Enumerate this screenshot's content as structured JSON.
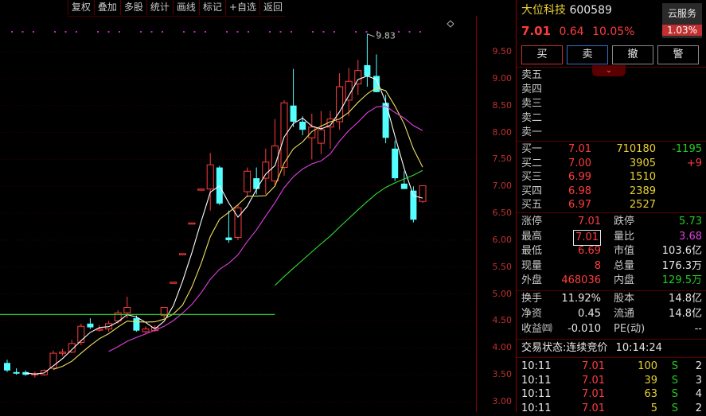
{
  "toolbar": [
    "复权",
    "叠加",
    "多股",
    "统计",
    "画线",
    "标记",
    "+自选",
    "返回"
  ],
  "chart_data": {
    "type": "candlestick",
    "peak_label": "9.83",
    "y_ticks": [
      "9.50",
      "9.00",
      "8.50",
      "8.00",
      "7.50",
      "7.00",
      "6.50",
      "6.00",
      "5.50",
      "5.00",
      "4.50",
      "4.00",
      "3.50",
      "3.00"
    ],
    "candles": [
      {
        "o": 3.72,
        "h": 3.78,
        "l": 3.55,
        "c": 3.58
      },
      {
        "o": 3.55,
        "h": 3.62,
        "l": 3.5,
        "c": 3.52
      },
      {
        "o": 3.55,
        "h": 3.58,
        "l": 3.48,
        "c": 3.5
      },
      {
        "o": 3.5,
        "h": 3.56,
        "l": 3.45,
        "c": 3.52
      },
      {
        "o": 3.5,
        "h": 3.6,
        "l": 3.48,
        "c": 3.58
      },
      {
        "o": 3.62,
        "h": 3.95,
        "l": 3.6,
        "c": 3.9
      },
      {
        "o": 3.9,
        "h": 3.98,
        "l": 3.85,
        "c": 3.92
      },
      {
        "o": 3.92,
        "h": 4.15,
        "l": 3.9,
        "c": 4.08
      },
      {
        "o": 4.1,
        "h": 4.45,
        "l": 4.05,
        "c": 4.4
      },
      {
        "o": 4.45,
        "h": 4.55,
        "l": 4.35,
        "c": 4.38
      },
      {
        "o": 4.35,
        "h": 4.42,
        "l": 4.3,
        "c": 4.35
      },
      {
        "o": 4.35,
        "h": 4.5,
        "l": 4.3,
        "c": 4.45
      },
      {
        "o": 4.5,
        "h": 4.7,
        "l": 4.45,
        "c": 4.65
      },
      {
        "o": 4.65,
        "h": 4.95,
        "l": 4.55,
        "c": 4.75
      },
      {
        "o": 4.55,
        "h": 4.6,
        "l": 4.3,
        "c": 4.32
      },
      {
        "o": 4.3,
        "h": 4.4,
        "l": 4.25,
        "c": 4.35
      },
      {
        "o": 4.32,
        "h": 4.42,
        "l": 4.3,
        "c": 4.38
      },
      {
        "o": 4.6,
        "h": 4.75,
        "l": 4.55,
        "c": 4.75
      },
      {
        "o": 5.22,
        "h": 5.22,
        "l": 5.22,
        "c": 5.22
      },
      {
        "o": 5.75,
        "h": 5.75,
        "l": 5.75,
        "c": 5.75
      },
      {
        "o": 6.32,
        "h": 6.32,
        "l": 6.32,
        "c": 6.32
      },
      {
        "o": 6.95,
        "h": 6.95,
        "l": 6.95,
        "c": 6.95
      },
      {
        "o": 6.95,
        "h": 7.62,
        "l": 6.55,
        "c": 7.4
      },
      {
        "o": 7.35,
        "h": 7.38,
        "l": 6.65,
        "c": 6.68
      },
      {
        "o": 6.05,
        "h": 6.55,
        "l": 5.95,
        "c": 6.0
      },
      {
        "o": 6.05,
        "h": 6.65,
        "l": 6.0,
        "c": 6.6
      },
      {
        "o": 6.9,
        "h": 7.35,
        "l": 6.8,
        "c": 7.28
      },
      {
        "o": 7.15,
        "h": 7.35,
        "l": 6.85,
        "c": 6.95
      },
      {
        "o": 7.15,
        "h": 7.7,
        "l": 6.85,
        "c": 7.45
      },
      {
        "o": 7.1,
        "h": 8.25,
        "l": 7.0,
        "c": 7.75
      },
      {
        "o": 7.35,
        "h": 8.6,
        "l": 7.2,
        "c": 8.55
      },
      {
        "o": 8.5,
        "h": 9.18,
        "l": 8.1,
        "c": 8.2
      },
      {
        "o": 8.2,
        "h": 8.3,
        "l": 7.95,
        "c": 8.05
      },
      {
        "o": 7.9,
        "h": 8.35,
        "l": 7.5,
        "c": 8.1
      },
      {
        "o": 7.8,
        "h": 8.4,
        "l": 7.6,
        "c": 8.05
      },
      {
        "o": 8.1,
        "h": 8.4,
        "l": 7.7,
        "c": 8.25
      },
      {
        "o": 8.2,
        "h": 9.1,
        "l": 8.05,
        "c": 8.85
      },
      {
        "o": 8.6,
        "h": 9.2,
        "l": 8.3,
        "c": 8.95
      },
      {
        "o": 8.9,
        "h": 9.35,
        "l": 8.7,
        "c": 9.15
      },
      {
        "o": 9.25,
        "h": 9.83,
        "l": 8.85,
        "c": 9.05
      },
      {
        "o": 9.05,
        "h": 9.45,
        "l": 8.75,
        "c": 8.75
      },
      {
        "o": 8.55,
        "h": 8.7,
        "l": 7.8,
        "c": 7.9
      },
      {
        "o": 7.7,
        "h": 7.85,
        "l": 7.1,
        "c": 7.15
      },
      {
        "o": 7.05,
        "h": 7.28,
        "l": 6.95,
        "c": 6.95
      },
      {
        "o": 6.92,
        "h": 7.0,
        "l": 6.33,
        "c": 6.38
      },
      {
        "o": 6.72,
        "h": 7.01,
        "l": 6.69,
        "c": 7.01
      }
    ]
  },
  "stock": {
    "name": "大位科技",
    "code": "600589",
    "price": "7.01",
    "change": "0.64",
    "pct": "10.05%",
    "cloud_label": "云服务",
    "cloud_pct": "1.03%"
  },
  "actions": [
    "买",
    "卖",
    "撤",
    "警"
  ],
  "asks": [
    {
      "label": "卖五"
    },
    {
      "label": "卖四"
    },
    {
      "label": "卖三"
    },
    {
      "label": "卖二"
    },
    {
      "label": "卖一"
    }
  ],
  "bids": [
    {
      "label": "买一",
      "price": "7.01",
      "vol": "710180",
      "delta": "-1195"
    },
    {
      "label": "买二",
      "price": "7.00",
      "vol": "3905",
      "delta": "+9"
    },
    {
      "label": "买三",
      "price": "6.99",
      "vol": "1510",
      "delta": ""
    },
    {
      "label": "买四",
      "price": "6.98",
      "vol": "2389",
      "delta": ""
    },
    {
      "label": "买五",
      "price": "6.97",
      "vol": "2527",
      "delta": ""
    }
  ],
  "stats": [
    {
      "l1": "涨停",
      "v1": "7.01",
      "l2": "跌停",
      "v2": "5.73"
    },
    {
      "l1": "最高",
      "v1": "7.01",
      "l2": "量比",
      "v2": "3.68"
    },
    {
      "l1": "最低",
      "v1": "6.69",
      "l2": "市值",
      "v2": "103.6亿"
    },
    {
      "l1": "现量",
      "v1": "8",
      "l2": "总量",
      "v2": "176.3万"
    },
    {
      "l1": "外盘",
      "v1": "468036",
      "l2": "内盘",
      "v2": "129.5万"
    }
  ],
  "stats2": [
    {
      "l1": "换手",
      "v1": "11.92%",
      "l2": "股本",
      "v2": "14.8亿"
    },
    {
      "l1": "净资",
      "v1": "0.45",
      "l2": "流通",
      "v2": "14.8亿"
    },
    {
      "l1": "收益㈣",
      "v1": "-0.010",
      "l2": "PE(动)",
      "v2": "--"
    }
  ],
  "status": {
    "label": "交易状态:",
    "state": "连续竞价",
    "time": "10:14:24"
  },
  "ticks": [
    {
      "t": "10:11",
      "p": "7.01",
      "v": "100",
      "s": "S",
      "n": "2"
    },
    {
      "t": "10:11",
      "p": "7.01",
      "v": "39",
      "s": "S",
      "n": "3"
    },
    {
      "t": "10:11",
      "p": "7.01",
      "v": "63",
      "s": "S",
      "n": "4"
    },
    {
      "t": "10:11",
      "p": "7.01",
      "v": "5",
      "s": "S",
      "n": "2"
    }
  ]
}
